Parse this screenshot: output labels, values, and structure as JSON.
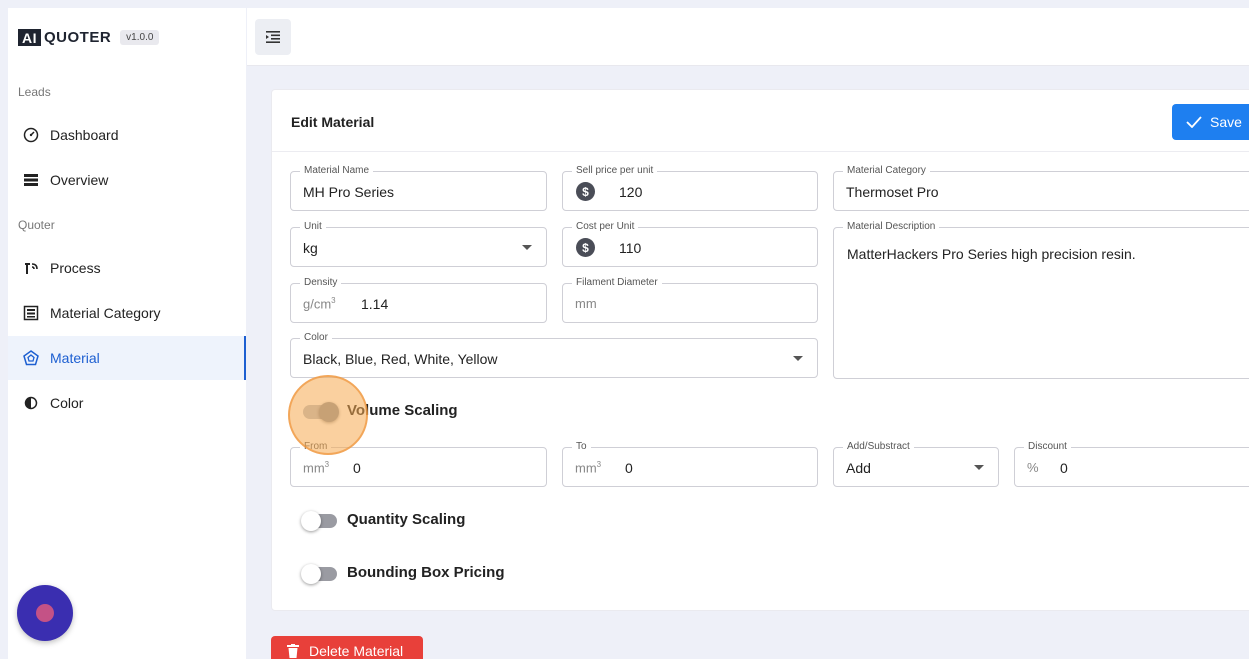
{
  "app": {
    "logo_mark": "AI",
    "logo_text": "QUOTER",
    "version": "v1.0.0"
  },
  "sidebar": {
    "section_leads": "Leads",
    "section_quoter": "Quoter",
    "items": [
      {
        "label": "Dashboard",
        "icon": "gauge-icon"
      },
      {
        "label": "Overview",
        "icon": "list-icon"
      },
      {
        "label": "Process",
        "icon": "process-icon"
      },
      {
        "label": "Material Category",
        "icon": "category-icon"
      },
      {
        "label": "Material",
        "icon": "material-icon",
        "active": true
      },
      {
        "label": "Color",
        "icon": "contrast-icon"
      }
    ]
  },
  "card": {
    "title": "Edit Material",
    "save_label": "Save"
  },
  "form": {
    "material_name": {
      "label": "Material Name",
      "value": "MH Pro Series"
    },
    "sell_price": {
      "label": "Sell price per unit",
      "value": "120"
    },
    "material_category": {
      "label": "Material Category",
      "value": "Thermoset Pro"
    },
    "unit": {
      "label": "Unit",
      "value": "kg"
    },
    "cost_per_unit": {
      "label": "Cost per Unit",
      "value": "110"
    },
    "material_description": {
      "label": "Material Description",
      "value": "MatterHackers Pro Series high precision resin."
    },
    "density": {
      "label": "Density",
      "unit": "g/cm",
      "unit_sup": "3",
      "value": "1.14"
    },
    "filament_diameter": {
      "label": "Filament Diameter",
      "placeholder": "mm"
    },
    "color": {
      "label": "Color",
      "value": "Black, Blue, Red, White, Yellow"
    }
  },
  "volume_scaling": {
    "label": "Volume Scaling",
    "enabled": true,
    "from": {
      "label": "From",
      "unit": "mm",
      "unit_sup": "3",
      "value": "0"
    },
    "to": {
      "label": "To",
      "unit": "mm",
      "unit_sup": "3",
      "value": "0"
    },
    "add_subtract": {
      "label": "Add/Substract",
      "value": "Add"
    },
    "discount": {
      "label": "Discount",
      "unit": "%",
      "value": "0"
    }
  },
  "quantity_scaling": {
    "label": "Quantity Scaling",
    "enabled": false
  },
  "bounding_box": {
    "label": "Bounding Box Pricing",
    "enabled": false
  },
  "delete_label": "Delete Material",
  "colors": {
    "accent": "#1e7ff0",
    "active_nav": "#1d5fd1",
    "danger": "#e8403a",
    "fab": "#3a2eb0"
  }
}
